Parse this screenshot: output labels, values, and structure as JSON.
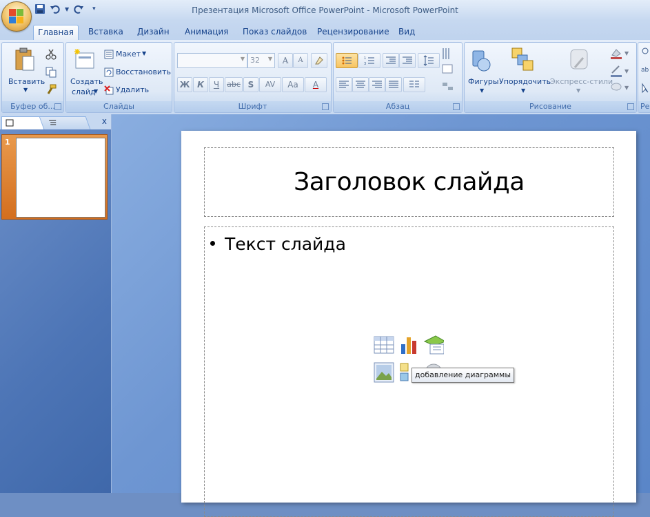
{
  "window": {
    "title": "Презентация Microsoft Office PowerPoint - Microsoft PowerPoint"
  },
  "tabs": [
    {
      "label": "Главная"
    },
    {
      "label": "Вставка"
    },
    {
      "label": "Дизайн"
    },
    {
      "label": "Анимация"
    },
    {
      "label": "Показ слайдов"
    },
    {
      "label": "Рецензирование"
    },
    {
      "label": "Вид"
    }
  ],
  "ribbon": {
    "clipboard": {
      "paste_label": "Вставить",
      "group_label": "Буфер об..."
    },
    "slides": {
      "new_slide_line1": "Создать",
      "new_slide_line2": "слайд",
      "layout_label": "Макет",
      "reset_label": "Восстановить",
      "delete_label": "Удалить",
      "group_label": "Слайды"
    },
    "font": {
      "font_name": "",
      "font_size": "32",
      "bold": "Ж",
      "italic": "К",
      "underline": "Ч",
      "strike": "abc",
      "shadow": "S",
      "spacing": "AV",
      "case": "Aa",
      "color": "A",
      "grow": "A",
      "shrink": "A",
      "group_label": "Шрифт"
    },
    "paragraph": {
      "group_label": "Абзац"
    },
    "drawing": {
      "shapes_label": "Фигуры",
      "arrange_label": "Упорядочить",
      "quick_styles_label": "Экспресс-стили",
      "group_label": "Рисование"
    },
    "editing": {
      "group_label_partial": "Ре"
    }
  },
  "panel": {
    "close_glyph": "x",
    "slide_number": "1"
  },
  "slide": {
    "title": "Заголовок слайда",
    "body_text": "Текст слайда"
  },
  "tooltip": {
    "text": "добавление диаграммы"
  },
  "colors": {
    "accent_orange": "#e28a35",
    "ribbon_blue": "#15428b",
    "workspace": "#6e96d2"
  }
}
